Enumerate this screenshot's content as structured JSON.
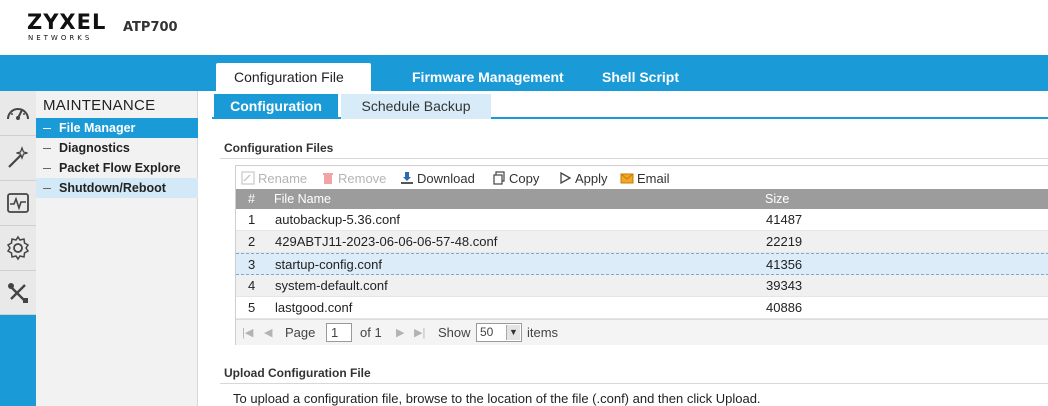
{
  "header": {
    "logo_main": "ZYXEL",
    "logo_sub": "NETWORKS",
    "model": "ATP700"
  },
  "main_tabs": [
    {
      "label": "Configuration File",
      "active": true
    },
    {
      "label": "Firmware Management",
      "active": false
    },
    {
      "label": "Shell Script",
      "active": false
    }
  ],
  "iconbar": [
    {
      "icon": "dashboard-icon"
    },
    {
      "icon": "wizard-icon"
    },
    {
      "icon": "monitor-icon"
    },
    {
      "icon": "gear-icon"
    },
    {
      "icon": "tools-icon"
    }
  ],
  "sidebar": {
    "title": "MAINTENANCE",
    "items": [
      {
        "label": "File Manager",
        "state": "active"
      },
      {
        "label": "Diagnostics",
        "state": "normal"
      },
      {
        "label": "Packet Flow Explore",
        "state": "normal"
      },
      {
        "label": "Shutdown/Reboot",
        "state": "hover"
      }
    ]
  },
  "sub_tabs": [
    {
      "label": "Configuration",
      "active": true
    },
    {
      "label": "Schedule Backup",
      "active": false
    }
  ],
  "config_files": {
    "section_title": "Configuration Files",
    "toolbar": {
      "rename": "Rename",
      "remove": "Remove",
      "download": "Download",
      "copy": "Copy",
      "apply": "Apply",
      "email": "Email"
    },
    "columns": {
      "index": "#",
      "name": "File Name",
      "size": "Size"
    },
    "rows": [
      {
        "index": "1",
        "name": "autobackup-5.36.conf",
        "size": "41487"
      },
      {
        "index": "2",
        "name": "429ABTJ11-2023-06-06-06-57-48.conf",
        "size": "22219"
      },
      {
        "index": "3",
        "name": "startup-config.conf",
        "size": "41356"
      },
      {
        "index": "4",
        "name": "system-default.conf",
        "size": "39343"
      },
      {
        "index": "5",
        "name": "lastgood.conf",
        "size": "40886"
      }
    ],
    "pager": {
      "page_label": "Page",
      "page_value": "1",
      "of_label": "of 1",
      "show_label": "Show",
      "show_value": "50",
      "items_label": "items"
    }
  },
  "upload": {
    "section_title": "Upload Configuration File",
    "description": "To upload a configuration file, browse to the location of the file (.conf) and then click Upload."
  },
  "colors": {
    "accent": "#1a9bd7",
    "selected_row": "#dcecf8",
    "header_gray": "#9c9c9c"
  }
}
